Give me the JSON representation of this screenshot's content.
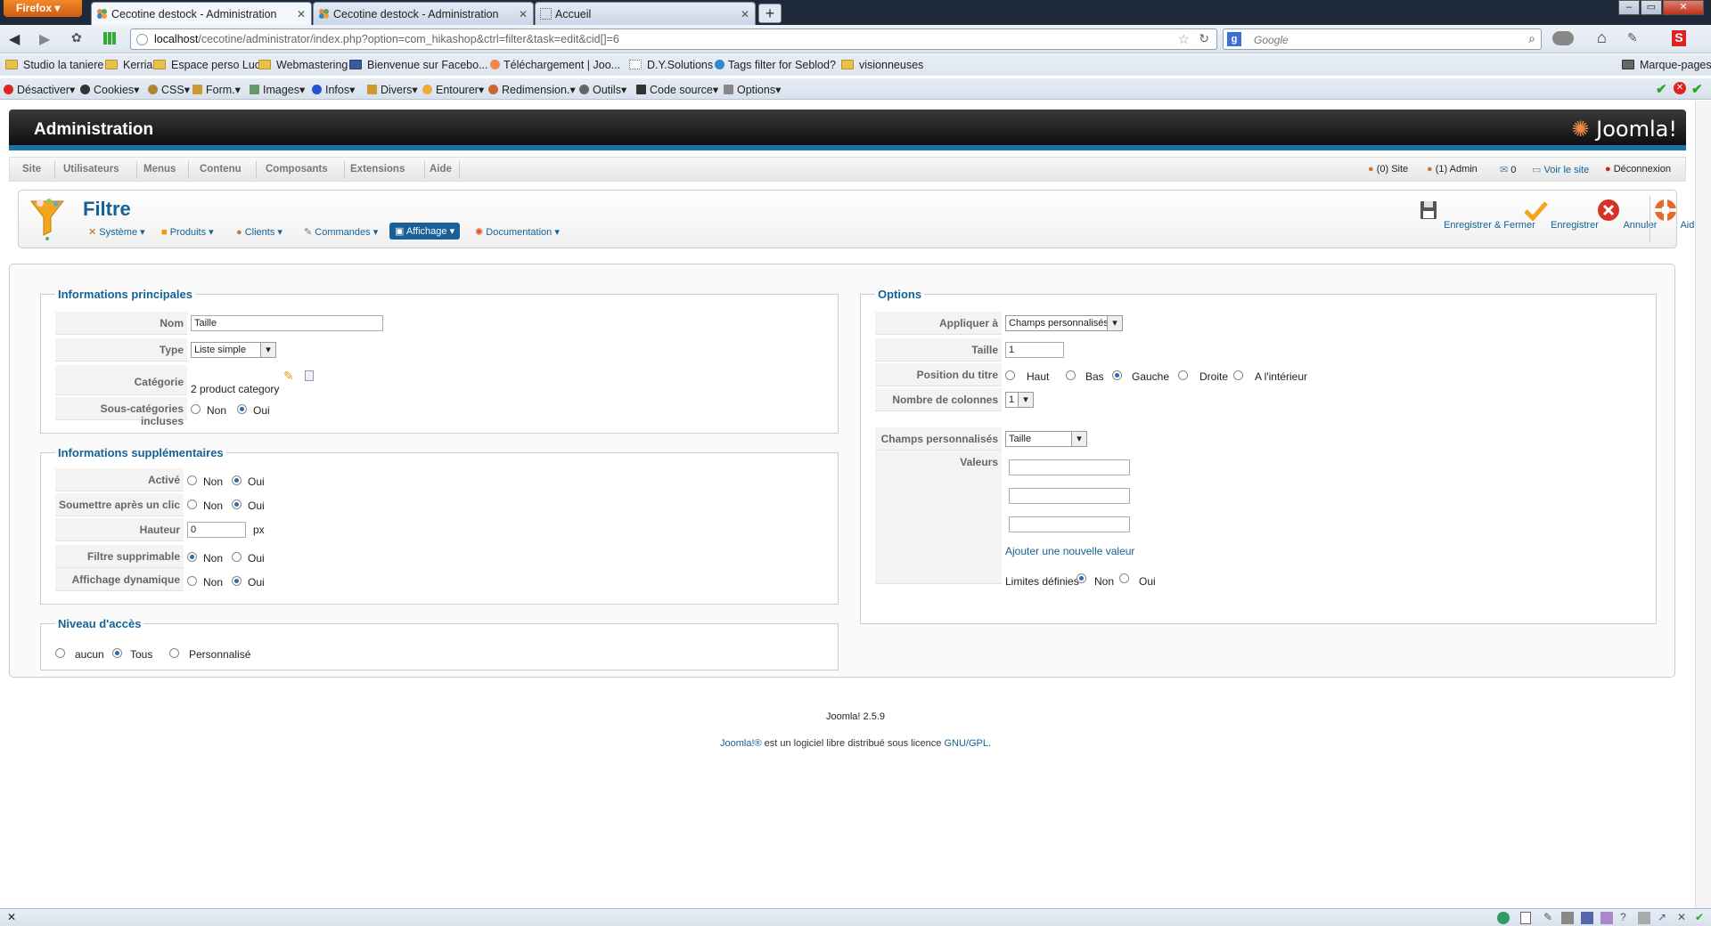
{
  "browser": {
    "brand": "Firefox",
    "tabs": [
      {
        "label": "Cecotine destock - Administration",
        "active": true
      },
      {
        "label": "Cecotine destock - Administration",
        "active": false
      },
      {
        "label": "Accueil",
        "active": false
      }
    ],
    "url_host": "localhost",
    "url_path": "/cecotine/administrator/index.php?option=com_hikashop&ctrl=filter&task=edit&cid[]=6",
    "search_placeholder": "Google",
    "bookmarks_right": "Marque-pages"
  },
  "bookmarks": [
    "Studio la taniere",
    "Kerria",
    "Espace perso Luc",
    "Webmastering",
    "Bienvenue sur Facebo...",
    "Téléchargement | Joo...",
    "D.Y.Solutions",
    "Tags filter for Seblod?",
    "visionneuses"
  ],
  "webdev": [
    "Désactiver",
    "Cookies",
    "CSS",
    "Form.",
    "Images",
    "Infos",
    "Divers",
    "Entourer",
    "Redimension.",
    "Outils",
    "Code source",
    "Options"
  ],
  "admin": {
    "header_title": "Administration",
    "logo": "Joomla!",
    "menu": [
      "Site",
      "Utilisateurs",
      "Menus",
      "Contenu",
      "Composants",
      "Extensions",
      "Aide"
    ],
    "status": {
      "site_users": "(0) Site",
      "admin_users": "(1) Admin",
      "messages": "0",
      "view_site": "Voir le site",
      "logout": "Déconnexion"
    }
  },
  "toolbar": {
    "title": "Filtre",
    "submenu": [
      "Système",
      "Produits",
      "Clients",
      "Commandes",
      "Affichage",
      "Documentation"
    ],
    "active_submenu": "Affichage",
    "buttons": {
      "save_close": "Enregistrer & Fermer",
      "save": "Enregistrer",
      "cancel": "Annuler",
      "help": "Aide"
    }
  },
  "main_info": {
    "legend": "Informations principales",
    "nom_label": "Nom",
    "nom_value": "Taille",
    "type_label": "Type",
    "type_value": "Liste simple",
    "categorie_label": "Catégorie",
    "categorie_value": "2 product category",
    "subcat_label": "Sous-catégories incluses",
    "non": "Non",
    "oui": "Oui",
    "subcat_selected": "Oui"
  },
  "extra_info": {
    "legend": "Informations supplémentaires",
    "active_label": "Activé",
    "active_selected": "Oui",
    "submit_label": "Soumettre après un clic",
    "submit_selected": "Oui",
    "hauteur_label": "Hauteur",
    "hauteur_value": "0",
    "hauteur_unit": "px",
    "deletable_label": "Filtre supprimable",
    "deletable_selected": "Non",
    "dynamic_label": "Affichage dynamique",
    "dynamic_selected": "Oui",
    "non": "Non",
    "oui": "Oui"
  },
  "access": {
    "legend": "Niveau d'accès",
    "opt_aucun": "aucun",
    "opt_tous": "Tous",
    "opt_perso": "Personnalisé",
    "selected": "Tous"
  },
  "options": {
    "legend": "Options",
    "apply_label": "Appliquer à",
    "apply_value": "Champs personnalisés",
    "taille_label": "Taille",
    "taille_value": "1",
    "position_label": "Position du titre",
    "positions": [
      "Haut",
      "Bas",
      "Gauche",
      "Droite",
      "A l'intérieur"
    ],
    "position_selected": "Gauche",
    "cols_label": "Nombre de colonnes",
    "cols_value": "1",
    "fields_label": "Champs personnalisés",
    "fields_value": "Taille",
    "values_label": "Valeurs",
    "add_value_link": "Ajouter une nouvelle valeur",
    "limits_label": "Limites définies",
    "non": "Non",
    "oui": "Oui",
    "limits_selected": "Non"
  },
  "footer": {
    "version": "Joomla! 2.5.9",
    "joomla_link": "Joomla!®",
    "license_text": " est un logiciel libre distribué sous licence ",
    "license_link": "GNU/GPL",
    "end": "."
  },
  "colors": {
    "accent": "#146295",
    "header_bar": "#1a73a8",
    "firefox": "#e8751d"
  }
}
